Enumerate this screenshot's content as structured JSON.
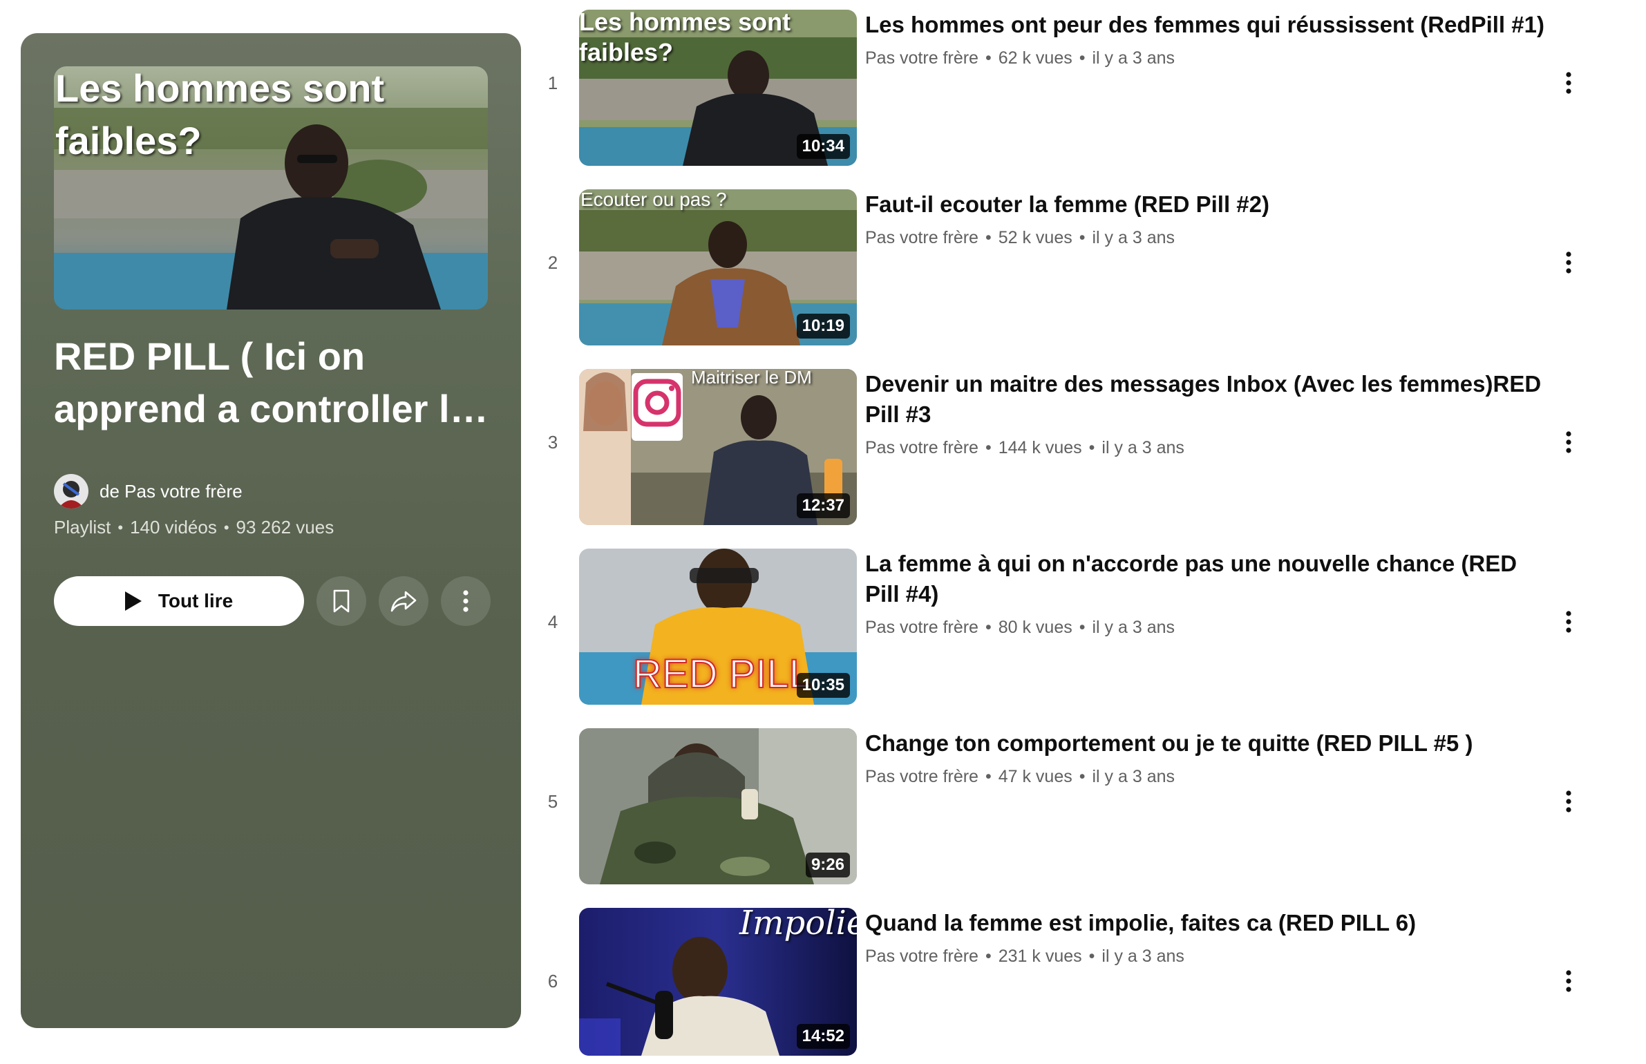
{
  "playlist": {
    "thumb_overlay_line1": "Les hommes sont",
    "thumb_overlay_line2": "faibles?",
    "title": "RED PILL ( Ici on apprend a controller la situation )",
    "owner": "de Pas votre frère",
    "meta": {
      "type": "Playlist",
      "videos": "140 vidéos",
      "views": "93 262 vues"
    },
    "play_all_label": "Tout lire"
  },
  "colors": {
    "panel": "#5f6a56",
    "title": "#0f0f0f",
    "meta": "#606060"
  },
  "icons": {
    "play": "play-icon",
    "save": "bookmark-icon",
    "share": "share-icon",
    "more": "more-vert-icon"
  },
  "videos": [
    {
      "index": "1",
      "title": "Les hommes ont peur des femmes qui réussissent (RedPill #1)",
      "channel": "Pas votre frère",
      "views": "62 k vues",
      "age": "il y a 3 ans",
      "duration": "10:34",
      "overlay": "Les hommes sont faibles?"
    },
    {
      "index": "2",
      "title": "Faut-il ecouter la femme (RED Pill #2)",
      "channel": "Pas votre frère",
      "views": "52 k vues",
      "age": "il y a 3 ans",
      "duration": "10:19",
      "overlay": "Ecouter ou pas ?"
    },
    {
      "index": "3",
      "title": "Devenir un maitre des messages Inbox (Avec les femmes)RED Pill #3",
      "channel": "Pas votre frère",
      "views": "144 k vues",
      "age": "il y a 3 ans",
      "duration": "12:37",
      "overlay": "Maitriser le DM"
    },
    {
      "index": "4",
      "title": "La femme à qui on n'accorde pas une nouvelle chance (RED Pill #4)",
      "channel": "Pas votre frère",
      "views": "80 k vues",
      "age": "il y a 3 ans",
      "duration": "10:35",
      "overlay": "RED PILL"
    },
    {
      "index": "5",
      "title": "Change ton comportement ou je te quitte (RED PILL #5 )",
      "channel": "Pas votre frère",
      "views": "47 k vues",
      "age": "il y a 3 ans",
      "duration": "9:26",
      "overlay": ""
    },
    {
      "index": "6",
      "title": "Quand la femme est impolie, faites ca (RED PILL 6)",
      "channel": "Pas votre frère",
      "views": "231 k vues",
      "age": "il y a 3 ans",
      "duration": "14:52",
      "overlay": "Impolie"
    }
  ]
}
